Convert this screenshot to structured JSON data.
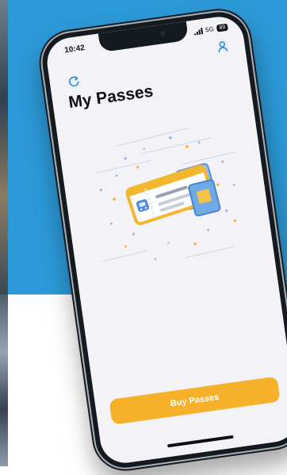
{
  "status_bar": {
    "time": "10:42",
    "network": "5G",
    "battery": "89"
  },
  "header": {
    "title": "My Passes",
    "refresh_icon": "refresh-icon",
    "profile_icon": "profile-icon"
  },
  "empty_state": {
    "illustration": "bus-pass-tickets-illustration"
  },
  "actions": {
    "buy_passes_label": "Buy Passes"
  },
  "colors": {
    "background_blue": "#2c9ad8",
    "accent_blue": "#1f8de0",
    "button_orange": "#f5b129"
  }
}
